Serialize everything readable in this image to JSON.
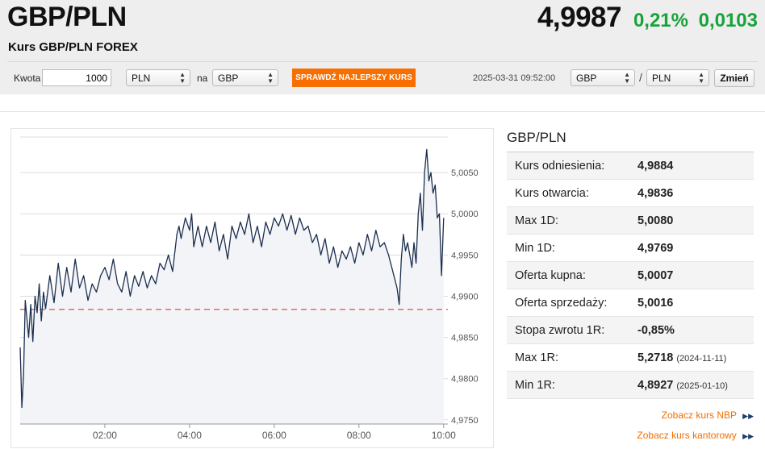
{
  "header": {
    "pair": "GBP/PLN",
    "subtitle": "Kurs GBP/PLN FOREX",
    "price": "4,9987",
    "change_pct": "0,21%",
    "change_abs": "0,0103",
    "change_color": "#18a33a"
  },
  "converter": {
    "amount_label": "Kwota",
    "amount_value": "1000",
    "from_currency": "PLN",
    "to_label": "na",
    "to_currency": "GBP",
    "best_rate_button": "SPRAWDŹ NAJLEPSZY KURS",
    "button_color": "#f76f00",
    "timestamp": "2025-03-31 09:52:00",
    "pair_base": "GBP",
    "pair_sep": "/",
    "pair_quote": "PLN",
    "change_button": "Zmień"
  },
  "sidebar": {
    "title": "GBP/PLN",
    "rows": [
      {
        "label": "Kurs odniesienia:",
        "value": "4,9884",
        "date": ""
      },
      {
        "label": "Kurs otwarcia:",
        "value": "4,9836",
        "date": ""
      },
      {
        "label": "Max 1D:",
        "value": "5,0080",
        "date": ""
      },
      {
        "label": "Min 1D:",
        "value": "4,9769",
        "date": ""
      },
      {
        "label": "Oferta kupna:",
        "value": "5,0007",
        "date": ""
      },
      {
        "label": "Oferta sprzedaży:",
        "value": "5,0016",
        "date": ""
      },
      {
        "label": "Stopa zwrotu 1R:",
        "value": "-0,85%",
        "date": ""
      },
      {
        "label": "Max 1R:",
        "value": "5,2718",
        "date": "(2024-11-11)"
      },
      {
        "label": "Min 1R:",
        "value": "4,8927",
        "date": "(2025-01-10)"
      }
    ],
    "links": [
      {
        "label": "Zobacz kurs NBP"
      },
      {
        "label": "Zobacz kurs kantorowy"
      }
    ],
    "link_color": "#f06e00"
  },
  "chart_data": {
    "type": "line",
    "y_ticks": [
      "5,0050",
      "5,0000",
      "4,9950",
      "4,9900",
      "4,9850",
      "4,9800",
      "4,9750"
    ],
    "x_ticks": [
      "02:00",
      "04:00",
      "06:00",
      "08:00",
      "10:00"
    ],
    "ylim": [
      4.9745,
      5.0095
    ],
    "xlim": [
      0.0,
      10.1
    ],
    "reference_value": 4.9884,
    "reference_color": "#e85a5a",
    "line_color": "#1c2f4f",
    "grid": true,
    "series": [
      {
        "x": [
          0.0,
          0.04,
          0.08,
          0.12,
          0.2,
          0.25,
          0.3,
          0.35,
          0.4,
          0.45,
          0.5,
          0.55,
          0.6,
          0.7,
          0.8,
          0.9,
          1.0,
          1.1,
          1.2,
          1.3,
          1.4,
          1.5,
          1.6,
          1.7,
          1.8,
          1.9,
          2.0,
          2.1,
          2.2,
          2.3,
          2.4,
          2.5,
          2.6,
          2.7,
          2.8,
          2.9,
          3.0,
          3.1,
          3.2,
          3.3,
          3.4,
          3.5,
          3.6,
          3.7,
          3.75,
          3.8,
          3.9,
          4.0,
          4.05,
          4.1,
          4.2,
          4.3,
          4.4,
          4.5,
          4.6,
          4.7,
          4.8,
          4.9,
          5.0,
          5.1,
          5.2,
          5.3,
          5.4,
          5.5,
          5.6,
          5.7,
          5.8,
          5.9,
          6.0,
          6.1,
          6.2,
          6.3,
          6.4,
          6.5,
          6.6,
          6.7,
          6.8,
          6.9,
          7.0,
          7.1,
          7.2,
          7.3,
          7.4,
          7.5,
          7.6,
          7.7,
          7.8,
          7.9,
          8.0,
          8.1,
          8.2,
          8.3,
          8.4,
          8.5,
          8.6,
          8.7,
          8.8,
          8.9,
          8.95,
          9.0,
          9.05,
          9.1,
          9.15,
          9.2,
          9.25,
          9.3,
          9.35,
          9.4,
          9.45,
          9.5,
          9.55,
          9.6,
          9.65,
          9.7,
          9.75,
          9.8,
          9.85,
          9.9,
          9.95,
          10.0
        ],
        "values": [
          4.9838,
          4.9765,
          4.9805,
          4.9895,
          4.985,
          4.989,
          4.9845,
          4.99,
          4.988,
          4.9915,
          4.987,
          4.9905,
          4.9885,
          4.9925,
          4.9892,
          4.994,
          4.99,
          4.9935,
          4.9905,
          4.9945,
          4.991,
          4.9925,
          4.9895,
          4.9915,
          4.9905,
          4.9925,
          4.9935,
          4.992,
          4.9945,
          4.9915,
          4.9905,
          4.993,
          4.99,
          4.9925,
          4.9912,
          4.993,
          4.991,
          4.9925,
          4.9915,
          4.994,
          4.9932,
          4.995,
          4.993,
          4.9975,
          4.9985,
          4.997,
          4.9995,
          4.998,
          5.0,
          4.996,
          4.9985,
          4.996,
          4.9985,
          4.9965,
          4.999,
          4.9955,
          4.9975,
          4.9945,
          4.9985,
          4.997,
          4.999,
          4.9975,
          5.0,
          4.9965,
          4.9985,
          4.996,
          4.999,
          4.9975,
          4.9995,
          4.9985,
          5.0,
          4.998,
          4.9998,
          4.9975,
          4.9995,
          4.998,
          4.9985,
          4.9965,
          4.9975,
          4.995,
          4.997,
          4.994,
          4.996,
          4.9935,
          4.9955,
          4.9945,
          4.996,
          4.994,
          4.9965,
          4.995,
          4.9975,
          4.9955,
          4.998,
          4.996,
          4.9965,
          4.995,
          4.993,
          4.991,
          4.989,
          4.9945,
          4.9975,
          4.9955,
          4.9965,
          4.995,
          4.9935,
          4.9965,
          4.994,
          5.0,
          5.0025,
          4.998,
          5.005,
          5.0078,
          5.004,
          5.005,
          5.0025,
          5.0035,
          4.9995,
          5.0,
          4.9925,
          4.9995
        ]
      }
    ]
  }
}
